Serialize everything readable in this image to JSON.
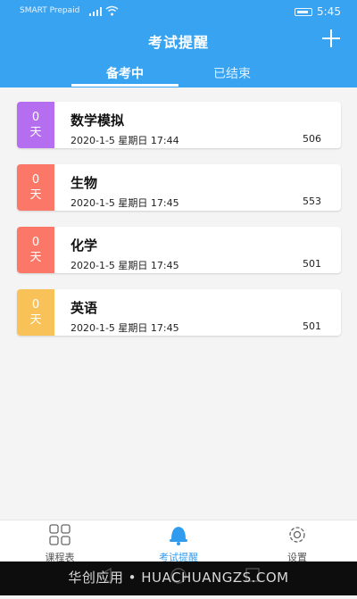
{
  "status_bar": {
    "carrier": "SMART Prepaid",
    "time": "5:45"
  },
  "header": {
    "title": "考试提醒",
    "tabs": [
      {
        "label": "备考中",
        "active": true
      },
      {
        "label": "已结束",
        "active": false
      }
    ],
    "add_icon": "plus-icon"
  },
  "exams": [
    {
      "days": "0",
      "unit": "天",
      "name": "数学模拟",
      "datetime": "2020-1-5 星期日 17:44",
      "count": "506",
      "color": "#b56ef0"
    },
    {
      "days": "0",
      "unit": "天",
      "name": "生物",
      "datetime": "2020-1-5 星期日 17:45",
      "count": "553",
      "color": "#fb7869"
    },
    {
      "days": "0",
      "unit": "天",
      "name": "化学",
      "datetime": "2020-1-5 星期日 17:45",
      "count": "501",
      "color": "#fb7869"
    },
    {
      "days": "0",
      "unit": "天",
      "name": "英语",
      "datetime": "2020-1-5 星期日 17:45",
      "count": "501",
      "color": "#f9c258"
    }
  ],
  "bottom_nav": [
    {
      "label": "课程表",
      "icon": "grid-icon",
      "active": false
    },
    {
      "label": "考试提醒",
      "icon": "bell-icon",
      "active": true
    },
    {
      "label": "设置",
      "icon": "gear-icon",
      "active": false
    }
  ],
  "watermark": "华创应用 • HUACHUANGZS.COM",
  "colors": {
    "primary": "#38a3f1",
    "active_nav": "#2f9cf0"
  }
}
